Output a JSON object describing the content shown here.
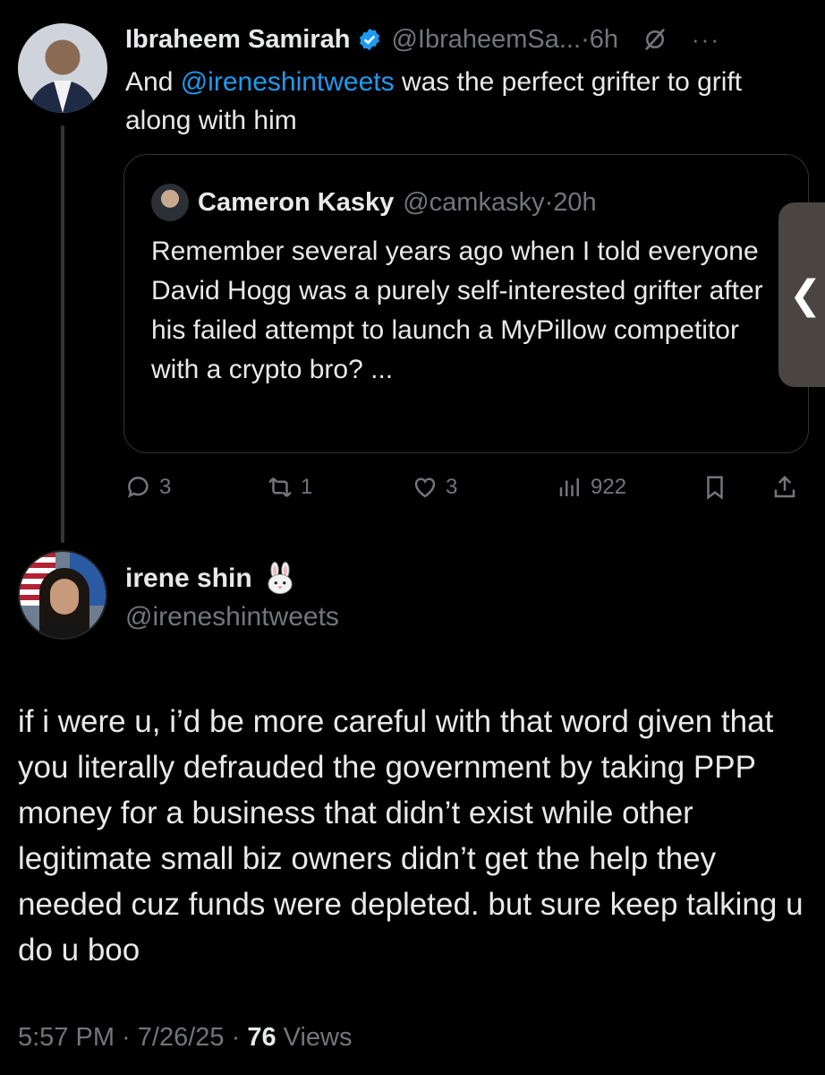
{
  "tweet1": {
    "name": "Ibraheem Samirah",
    "handle": "@IbraheemSa...",
    "separator": "·",
    "time": "6h",
    "text_prefix": "And ",
    "mention": "@ireneshintweets",
    "text_suffix": " was the perfect grifter to grift along with him",
    "more_label": "···",
    "quote": {
      "name": "Cameron Kasky",
      "handle": "@camkasky",
      "separator": "·",
      "time": "20h",
      "text": "Remember several years ago when I told everyone David Hogg was a purely self-interested grifter after his failed attempt to launch a MyPillow competitor with a crypto bro? ..."
    },
    "actions": {
      "replies": "3",
      "reposts": "1",
      "likes": "3",
      "views": "922"
    }
  },
  "side_tab": {
    "label": "❮"
  },
  "tweet2": {
    "name": "irene shin",
    "handle": "@ireneshintweets",
    "text": "if i were u, i’d be more careful with that word given that you literally defrauded the government by taking PPP money for a business that didn’t exist while other legitimate small biz owners didn’t get the help they needed cuz funds were depleted. but sure keep talking u do u boo",
    "time": "5:57 PM",
    "dot": " · ",
    "date": "7/26/25",
    "views_count": "76",
    "views_label": " Views"
  },
  "colors": {
    "background": "#000000",
    "text": "#e7e9ea",
    "secondary": "#71767b",
    "accent": "#1d9bf0",
    "border": "#2f3336"
  }
}
